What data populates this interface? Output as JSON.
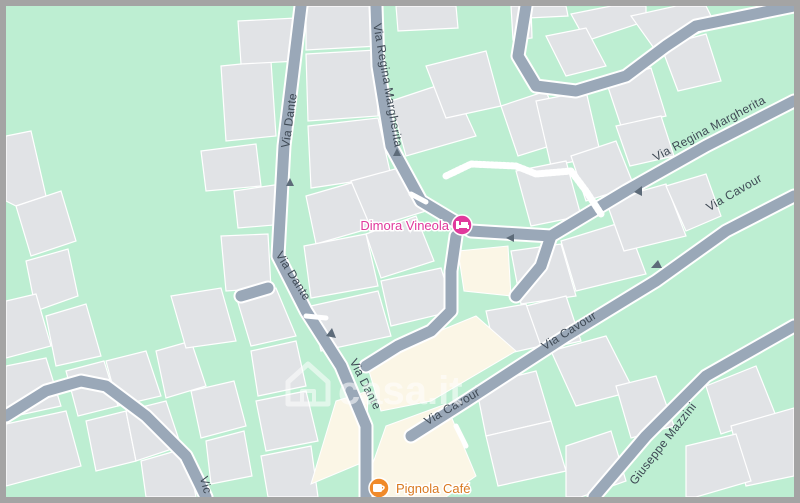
{
  "map": {
    "colors": {
      "park": "#bdeed2",
      "building": "#e1e3e6",
      "building_stroke": "#ffffff",
      "road": "#9aa8b8",
      "road_edge": "#ffffff",
      "plaza": "#fbf6e6",
      "lodging": "#e0399c",
      "food": "#f08a2a"
    },
    "streets": {
      "via_dante_north": "Via Dante",
      "via_dante_mid": "Via Dante",
      "via_dante_south": "Via Dante",
      "via_regina_margherita_north": "Via Regina Margherita",
      "via_regina_margherita_east": "Via Regina Margherita",
      "via_cavour_east": "Via Cavour",
      "via_cavour_mid": "Via Cavour",
      "via_cavour_south": "Via Cavour",
      "via_mazzini": "Giuseppe Mazzini",
      "via_left_bottom": "Vic"
    },
    "pois": [
      {
        "name": "Dimora Vineola",
        "icon": "hotel-bed-icon",
        "category": "lodging"
      },
      {
        "name": "Pignola Café",
        "icon": "coffee-cup-icon",
        "category": "food"
      }
    ],
    "watermark": "casa.it"
  }
}
